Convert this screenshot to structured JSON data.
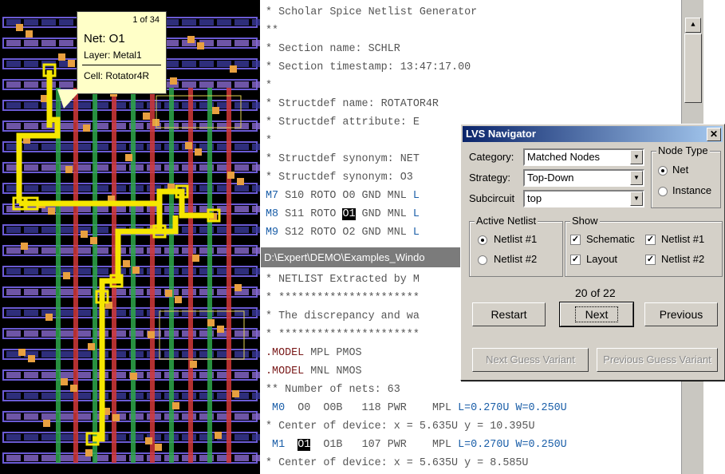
{
  "tooltip": {
    "count": "1 of 34",
    "net": "Net: O1",
    "layer": "Layer: Metal1",
    "cell": "Cell: Rotator4R"
  },
  "netlist_top": {
    "lines": [
      "* Scholar Spice Netlist Generator",
      "**",
      "* Section name: SCHLR",
      "* Section timestamp: 13:47:17.00",
      "*",
      "* Structdef name: ROTATOR4R",
      "* Structdef attribute: E",
      "*",
      "* Structdef synonym: NET",
      "* Structdef synonym: O3",
      "M7 S10 ROTO O0 GND MNL L",
      "M8 S11 ROTO O1 GND MNL L",
      "M9 S12 ROTO O2 GND MNL L"
    ]
  },
  "path_bar": "D:\\Expert\\DEMO\\Examples_Windo",
  "netlist_bottom": {
    "lines": [
      "* NETLIST Extracted by M",
      "* **********************",
      "* The discrepancy and wa",
      "* **********************",
      ".MODEL MPL PMOS",
      ".MODEL MNL NMOS",
      "** Number of nets: 63",
      " M0  O0  O0B   118 PWR    MPL L=0.270U W=0.250U",
      "* Center of device: x = 5.635U y = 10.395U",
      " M1  O1  O1B   107 PWR    MPL L=0.270U W=0.250U",
      "* Center of device: x = 5.635U y = 8.585U"
    ]
  },
  "dialog": {
    "title": "LVS Navigator",
    "close": "✕",
    "category_label": "Category:",
    "category_value": "Matched Nodes",
    "strategy_label": "Strategy:",
    "strategy_value": "Top-Down",
    "subcircuit_label": "Subcircuit",
    "subcircuit_value": "top",
    "node_type": {
      "title": "Node Type",
      "net": "Net",
      "instance": "Instance",
      "selected": "Net"
    },
    "active_netlist": {
      "title": "Active Netlist",
      "opt1": "Netlist #1",
      "opt2": "Netlist #2",
      "selected": "Netlist #1"
    },
    "show": {
      "title": "Show",
      "schematic": "Schematic",
      "layout": "Layout",
      "netlist1": "Netlist #1",
      "netlist2": "Netlist #2"
    },
    "counter": "20 of 22",
    "restart": "Restart",
    "next": "Next",
    "previous": "Previous",
    "next_guess": "Next Guess Variant",
    "prev_guess": "Previous Guess Variant"
  },
  "colors": {
    "titlebar": "#0a246a",
    "highlight_wire": "#f5e600",
    "dialog_bg": "#d4d0c8"
  }
}
